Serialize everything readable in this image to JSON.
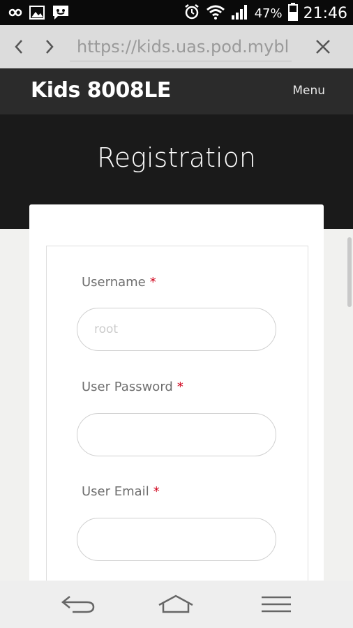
{
  "status_bar": {
    "battery": "47%",
    "time": "21:46",
    "icons": [
      "infinity-icon",
      "image-icon",
      "message-icon",
      "alarm-icon",
      "wifi-icon",
      "signal-icon",
      "battery-icon"
    ]
  },
  "browser": {
    "url": "https://kids.uas.pod.myblu",
    "icons": [
      "back-icon",
      "forward-icon",
      "close-icon"
    ]
  },
  "site": {
    "brand": "Kids 8008LE",
    "menu": "Menu",
    "title": "Registration"
  },
  "form": {
    "username_label": "Username",
    "username_placeholder": "root",
    "password_label": "User Password",
    "email_label": "User Email",
    "required_mark": "*"
  },
  "nav_bar": {
    "icons": [
      "back-arrow-icon",
      "home-icon",
      "menu-icon"
    ]
  },
  "colors": {
    "header": "#2b2b2b",
    "hero": "#1a1a1a",
    "required": "#d0021b",
    "page_bg": "#f1f1ef"
  }
}
